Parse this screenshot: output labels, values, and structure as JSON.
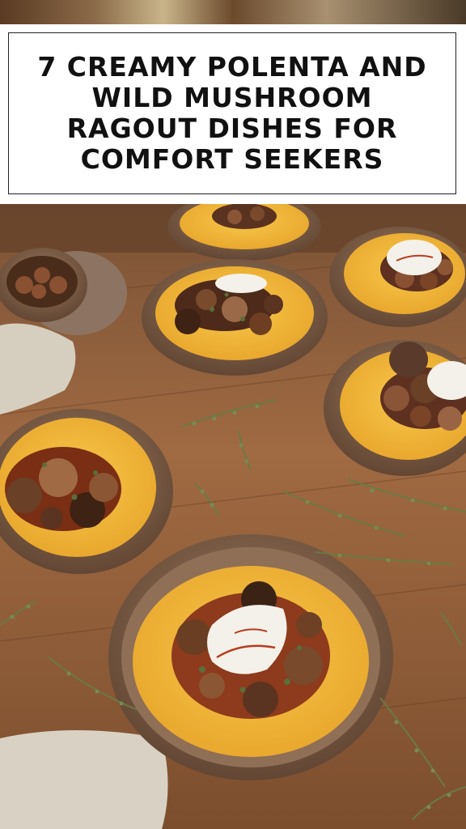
{
  "title": "7 CREAMY POLENTA AND WILD MUSHROOM RAGOUT DISHES FOR COMFORT SEEKERS",
  "colors": {
    "table": "#8a5a36",
    "polenta": "#f2b83a",
    "bowl": "#7a5a44",
    "mushroom": "#6a3e22",
    "sauce": "#8e3a1c",
    "cream": "#f4f1ea",
    "herb": "#5a6e3a",
    "cloth": "#d9d2c4"
  }
}
